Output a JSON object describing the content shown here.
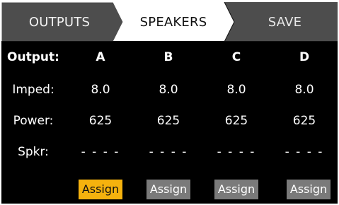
{
  "tabs": [
    {
      "label": "OUTPUTS"
    },
    {
      "label": "SPEAKERS"
    },
    {
      "label": "SAVE"
    }
  ],
  "active_tab": "SPEAKERS",
  "table": {
    "rows": [
      {
        "label": "Output:",
        "values": [
          "A",
          "B",
          "C",
          "D"
        ]
      },
      {
        "label": "Imped:",
        "values": [
          "8.0",
          "8.0",
          "8.0",
          "8.0"
        ]
      },
      {
        "label": "Power:",
        "values": [
          "625",
          "625",
          "625",
          "625"
        ]
      },
      {
        "label": "Spkr:",
        "values": [
          "- - - -",
          "- - - -",
          "- - - -",
          "- - - -"
        ]
      }
    ]
  },
  "assign_buttons": [
    {
      "label": "Assign",
      "state": "selected"
    },
    {
      "label": "Assign",
      "state": "normal"
    },
    {
      "label": "Assign",
      "state": "normal"
    },
    {
      "label": "Assign",
      "state": "normal"
    }
  ],
  "colors": {
    "background": "#000000",
    "tab_inactive": "#4d4d4d",
    "tab_active": "#ffffff",
    "button_selected": "#f5b20e",
    "button_normal": "#7a7a7a"
  }
}
